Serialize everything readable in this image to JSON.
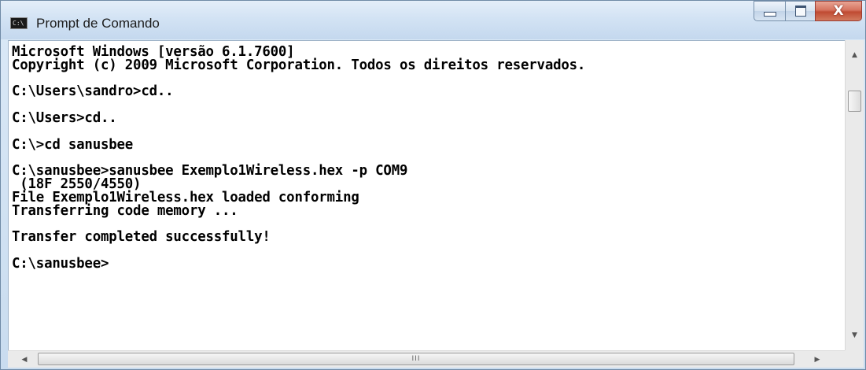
{
  "window": {
    "title": "Prompt de Comando",
    "app_icon": "cmd-icon",
    "app_icon_text": "C:\\",
    "buttons": {
      "minimize": "minimize-icon",
      "maximize": "maximize-icon",
      "close": "close-icon",
      "close_glyph": "X"
    }
  },
  "console": {
    "lines": [
      "Microsoft Windows [versão 6.1.7600]",
      "Copyright (c) 2009 Microsoft Corporation. Todos os direitos reservados.",
      "",
      "C:\\Users\\sandro>cd..",
      "",
      "C:\\Users>cd..",
      "",
      "C:\\>cd sanusbee",
      "",
      "C:\\sanusbee>sanusbee Exemplo1Wireless.hex -p COM9",
      " (18F 2550/4550)",
      "File Exemplo1Wireless.hex loaded conforming",
      "Transferring code memory ...",
      "",
      "Transfer completed successfully!",
      "",
      "C:\\sanusbee>"
    ]
  },
  "scrollbars": {
    "up_arrow": "▲",
    "down_arrow": "▼",
    "left_arrow": "◀",
    "right_arrow": "▶",
    "grip": "III"
  },
  "colors": {
    "console_bg": "#ffffff",
    "console_text": "#000000",
    "frame": "#c9dcef",
    "close_button": "#c04a32"
  }
}
